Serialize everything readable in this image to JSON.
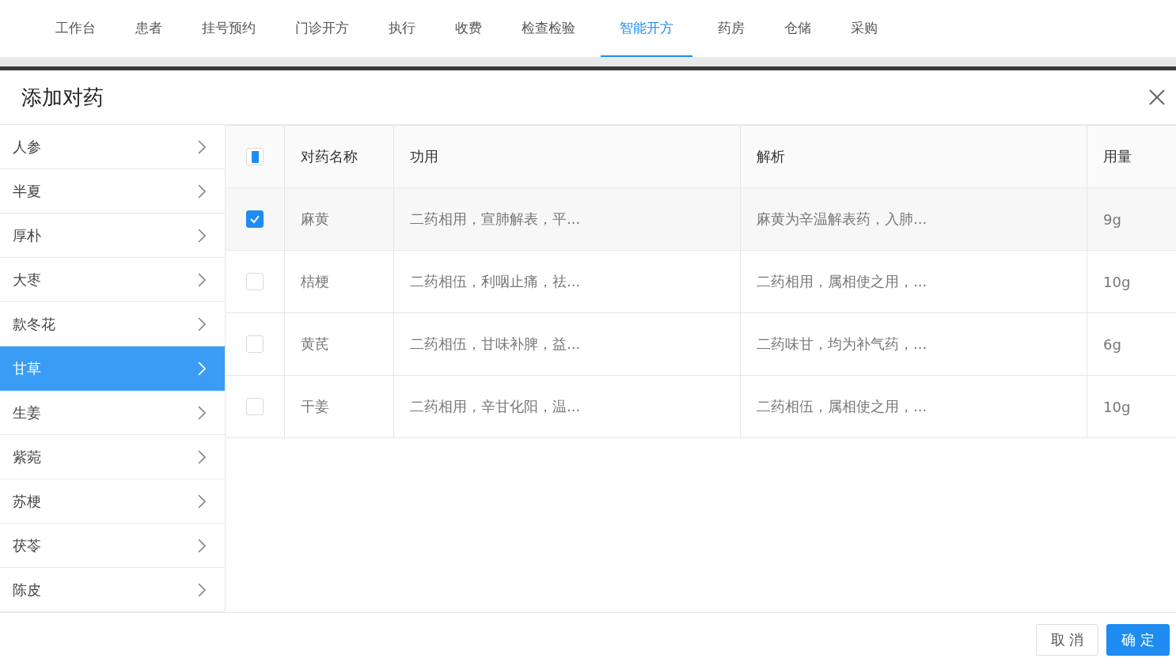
{
  "nav": [
    {
      "label": "工作台",
      "selected": false
    },
    {
      "label": "患者",
      "selected": false
    },
    {
      "label": "挂号预约",
      "selected": false
    },
    {
      "label": "门诊开方",
      "selected": false
    },
    {
      "label": "执行",
      "selected": false
    },
    {
      "label": "收费",
      "selected": false
    },
    {
      "label": "检查检验",
      "selected": false
    },
    {
      "label": "智能开方",
      "selected": true
    },
    {
      "label": "药房",
      "selected": false
    },
    {
      "label": "仓储",
      "selected": false
    },
    {
      "label": "采购",
      "selected": false
    }
  ],
  "dialog": {
    "title": "添加对药",
    "herbs": [
      {
        "label": "人参",
        "selected": false
      },
      {
        "label": "半夏",
        "selected": false
      },
      {
        "label": "厚朴",
        "selected": false
      },
      {
        "label": "大枣",
        "selected": false
      },
      {
        "label": "款冬花",
        "selected": false
      },
      {
        "label": "甘草",
        "selected": true
      },
      {
        "label": "生姜",
        "selected": false
      },
      {
        "label": "紫菀",
        "selected": false
      },
      {
        "label": "苏梗",
        "selected": false
      },
      {
        "label": "茯苓",
        "selected": false
      },
      {
        "label": "陈皮",
        "selected": false
      }
    ],
    "table": {
      "select_all": {
        "indeterminate": true
      },
      "columns": [
        "对药名称",
        "功用",
        "解析",
        "用量"
      ],
      "rows": [
        {
          "checked": true,
          "cells": [
            "麻黄",
            "二药相用，宣肺解表，平...",
            "麻黄为辛温解表药，入肺...",
            "9g"
          ]
        },
        {
          "checked": false,
          "cells": [
            "桔梗",
            "二药相伍，利咽止痛，祛...",
            "二药相用，属相使之用，...",
            "10g"
          ]
        },
        {
          "checked": false,
          "cells": [
            "黄芪",
            "二药相伍，甘味补脾，益...",
            "二药味甘，均为补气药，...",
            "6g"
          ]
        },
        {
          "checked": false,
          "cells": [
            "干姜",
            "二药相用，辛甘化阳，温...",
            "二药相伍，属相使之用，...",
            "10g"
          ]
        }
      ]
    },
    "buttons": {
      "cancel": "取 消",
      "confirm": "确 定"
    }
  }
}
